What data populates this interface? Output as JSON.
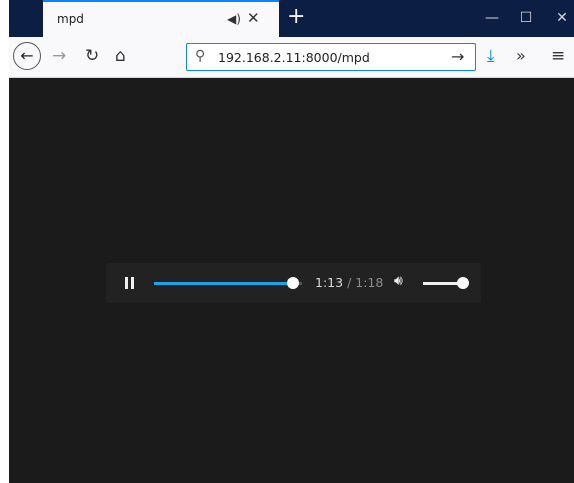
{
  "tab": {
    "title": "mpd",
    "audio_icon": "speaker-icon",
    "close_icon": "close-icon"
  },
  "new_tab_icon": "plus-icon",
  "window_controls": {
    "minimize": "—",
    "maximize": "☐",
    "close": "✕"
  },
  "nav": {
    "back_icon": "back-arrow-icon",
    "forward_icon": "forward-arrow-icon",
    "reload_icon": "reload-icon",
    "home_icon": "home-icon",
    "download_icon": "download-icon",
    "overflow_icon": "chevron-double-right-icon",
    "menu_icon": "hamburger-menu-icon"
  },
  "urlbar": {
    "url": "192.168.2.11:8000/mpd",
    "search_icon": "search-icon",
    "go_icon": "go-arrow-icon"
  },
  "player": {
    "state": "playing",
    "current_time": "1:13",
    "separator": "/",
    "duration": "1:18",
    "progress": 0.936,
    "volume": 1.0,
    "colors": {
      "progress": "#1aa5e6",
      "background": "#222222",
      "page_background": "#1b1b1b"
    }
  },
  "colors": {
    "titlebar": "#0d1e45",
    "accent": "#0a84ff"
  }
}
